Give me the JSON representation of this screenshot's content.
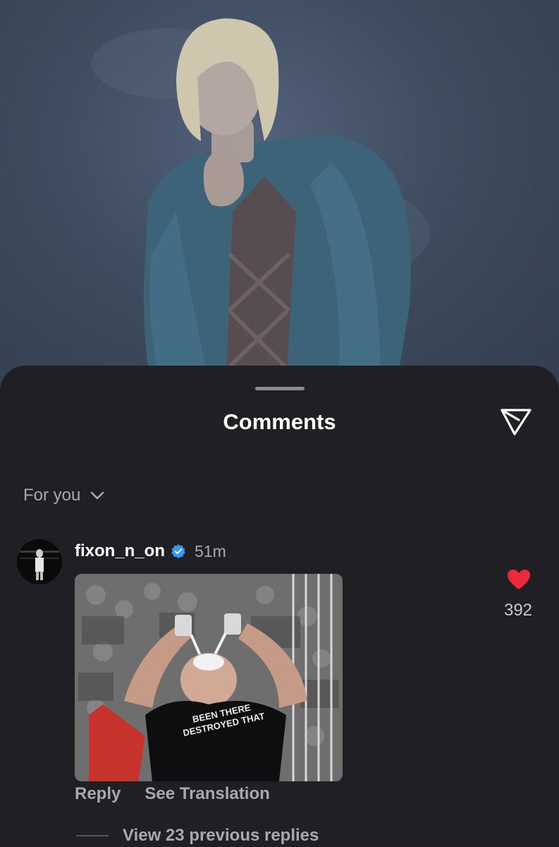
{
  "header": {
    "title": "Comments",
    "share_icon": "send-icon"
  },
  "filter": {
    "label": "For you",
    "icon": "chevron-down-icon"
  },
  "comment": {
    "username": "fixon_n_on",
    "verified_icon": "verified-badge-icon",
    "time": "51m",
    "gif_shirt_text": "BEEN THERE DESTROYED THAT",
    "likes": "392",
    "like_icon": "heart-icon",
    "reply_label": "Reply",
    "translate_label": "See Translation",
    "view_replies_label": "View 23 previous replies"
  },
  "colors": {
    "sheet_bg": "#202024",
    "text_primary": "#ffffff",
    "text_secondary": "#a8a8ad",
    "heart": "#ed2a3c",
    "verified": "#3897f0"
  }
}
